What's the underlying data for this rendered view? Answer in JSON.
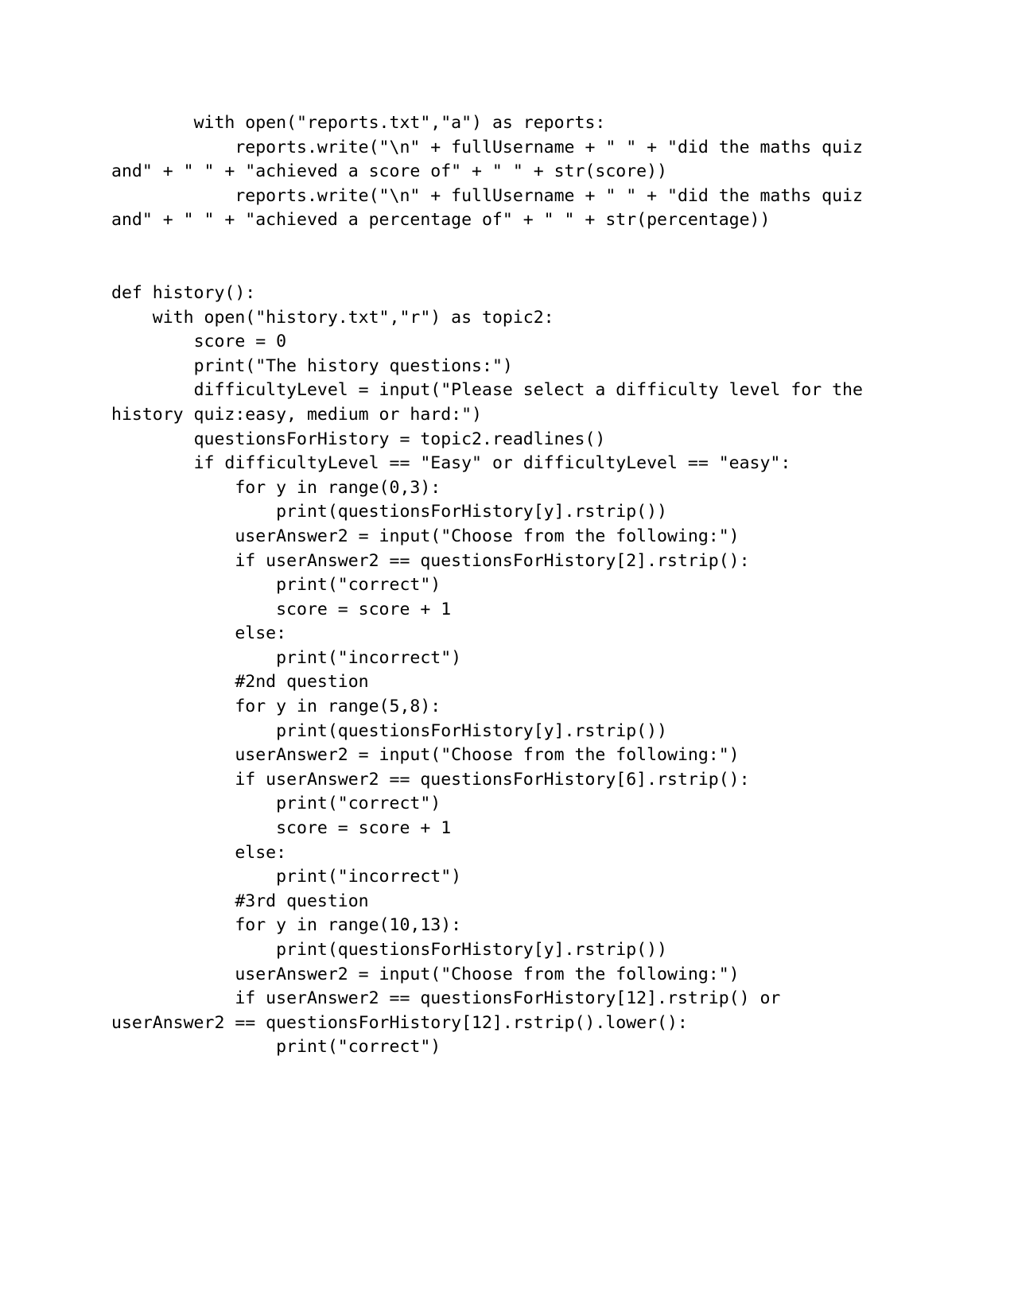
{
  "document": {
    "kind": "code-listing",
    "language": "Python",
    "page_background": "#ffffff",
    "text_color": "#000000",
    "blocks": [
      {
        "id": "reports-writing-block",
        "code": "        with open(\"reports.txt\",\"a\") as reports:\n            reports.write(\"\\n\" + fullUsername + \" \" + \"did the maths quiz and\" + \" \" + \"achieved a score of\" + \" \" + str(score))\n            reports.write(\"\\n\" + fullUsername + \" \" + \"did the maths quiz and\" + \" \" + \"achieved a percentage of\" + \" \" + str(percentage))"
      },
      {
        "id": "history-function-block",
        "code": "def history():\n    with open(\"history.txt\",\"r\") as topic2:\n        score = 0\n        print(\"The history questions:\")\n        difficultyLevel = input(\"Please select a difficulty level for the  history quiz:easy, medium or hard:\")\n        questionsForHistory = topic2.readlines()\n        if difficultyLevel == \"Easy\" or difficultyLevel == \"easy\":\n            for y in range(0,3):\n                print(questionsForHistory[y].rstrip())\n            userAnswer2 = input(\"Choose from the following:\")\n            if userAnswer2 == questionsForHistory[2].rstrip():\n                print(\"correct\")\n                score = score + 1\n            else:\n                print(\"incorrect\")\n            #2nd question\n            for y in range(5,8):\n                print(questionsForHistory[y].rstrip())\n            userAnswer2 = input(\"Choose from the following:\")\n            if userAnswer2 == questionsForHistory[6].rstrip():\n                print(\"correct\")\n                score = score + 1\n            else:\n                print(\"incorrect\")\n            #3rd question\n            for y in range(10,13):\n                print(questionsForHistory[y].rstrip())\n            userAnswer2 = input(\"Choose from the following:\")\n            if userAnswer2 == questionsForHistory[12].rstrip() or userAnswer2 == questionsForHistory[12].rstrip().lower():\n                print(\"correct\")"
      }
    ]
  }
}
